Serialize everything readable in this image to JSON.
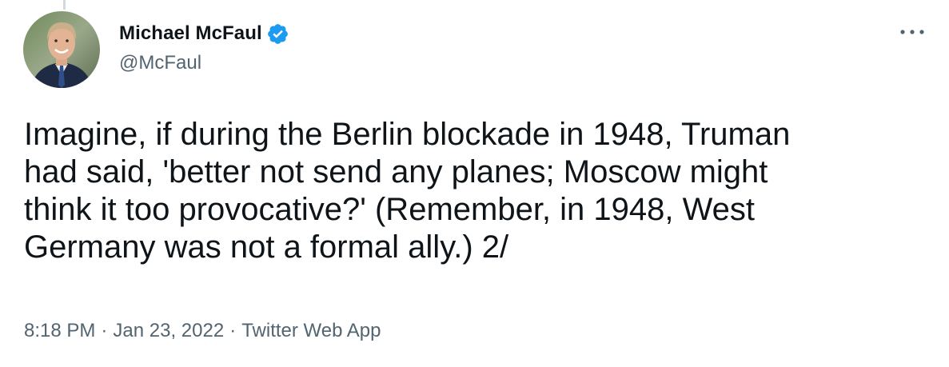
{
  "author": {
    "display_name": "Michael McFaul",
    "handle": "@McFaul",
    "verified": true,
    "avatar_icon": "profile-photo"
  },
  "tweet": {
    "text": "Imagine, if during the Berlin blockade in 1948, Truman\nhad said, 'better not send any planes; Moscow might\nthink it too provocative?' (Remember, in 1948, West\nGermany was not a formal ally.) 2/"
  },
  "meta": {
    "time": "8:18 PM",
    "separator": "·",
    "date": "Jan 23, 2022",
    "source": "Twitter Web App"
  },
  "colors": {
    "text_primary": "#0f1419",
    "text_secondary": "#536471",
    "verified_blue": "#1d9bf0"
  }
}
